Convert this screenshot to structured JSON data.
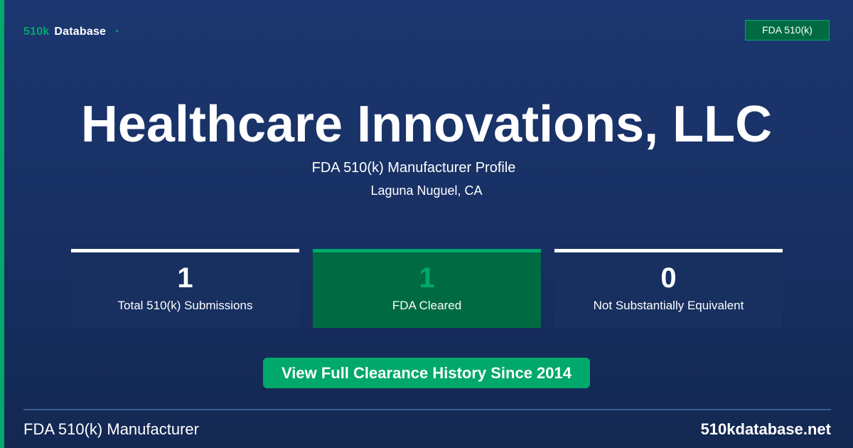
{
  "brand": {
    "accent": "510k",
    "name": "Database",
    "badge": "FDA 510(k)"
  },
  "hero": {
    "title": "Healthcare Innovations, LLC",
    "subtitle": "FDA 510(k) Manufacturer Profile",
    "location": "Laguna Nuguel, CA"
  },
  "stats": [
    {
      "value": "1",
      "label": "Total 510(k) Submissions"
    },
    {
      "value": "1",
      "label": "FDA Cleared"
    },
    {
      "value": "0",
      "label": "Not Substantially Equivalent"
    }
  ],
  "cta": {
    "label": "View Full Clearance History Since 2014"
  },
  "footer": {
    "left": "FDA 510(k) Manufacturer",
    "right": "510kdatabase.net"
  },
  "colors": {
    "background": "#1a3468",
    "accent_green": "#00a86b",
    "dark_green": "#006b42",
    "card": "#17305f",
    "text": "#ffffff"
  }
}
